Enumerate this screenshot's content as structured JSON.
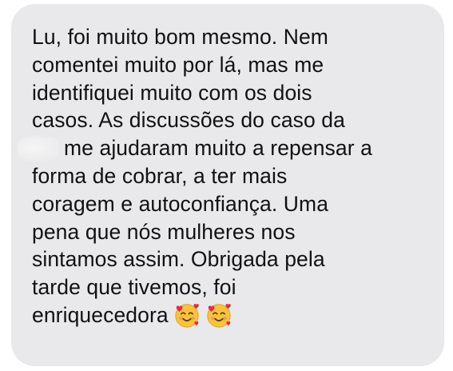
{
  "message": {
    "lines": [
      "Lu, foi muito bom mesmo. Nem",
      "comentei muito por lá, mas me",
      "identifiquei muito com os dois",
      "casos. As discussões do caso da",
      "me ajudaram muito a repensar a",
      "forma de cobrar, a ter mais",
      "coragem e autoconfiança. Uma",
      "pena que nós mulheres nos",
      "sintamos assim. Obrigada pela",
      "tarde que tivemos, foi",
      "enriquecedora"
    ],
    "redacted_name_icon": "blurred-redaction",
    "emojis": [
      "smiling-face-with-hearts-icon",
      "smiling-face-with-hearts-icon"
    ]
  },
  "colors": {
    "bubble_background": "#e9e9eb",
    "text": "#111111"
  }
}
